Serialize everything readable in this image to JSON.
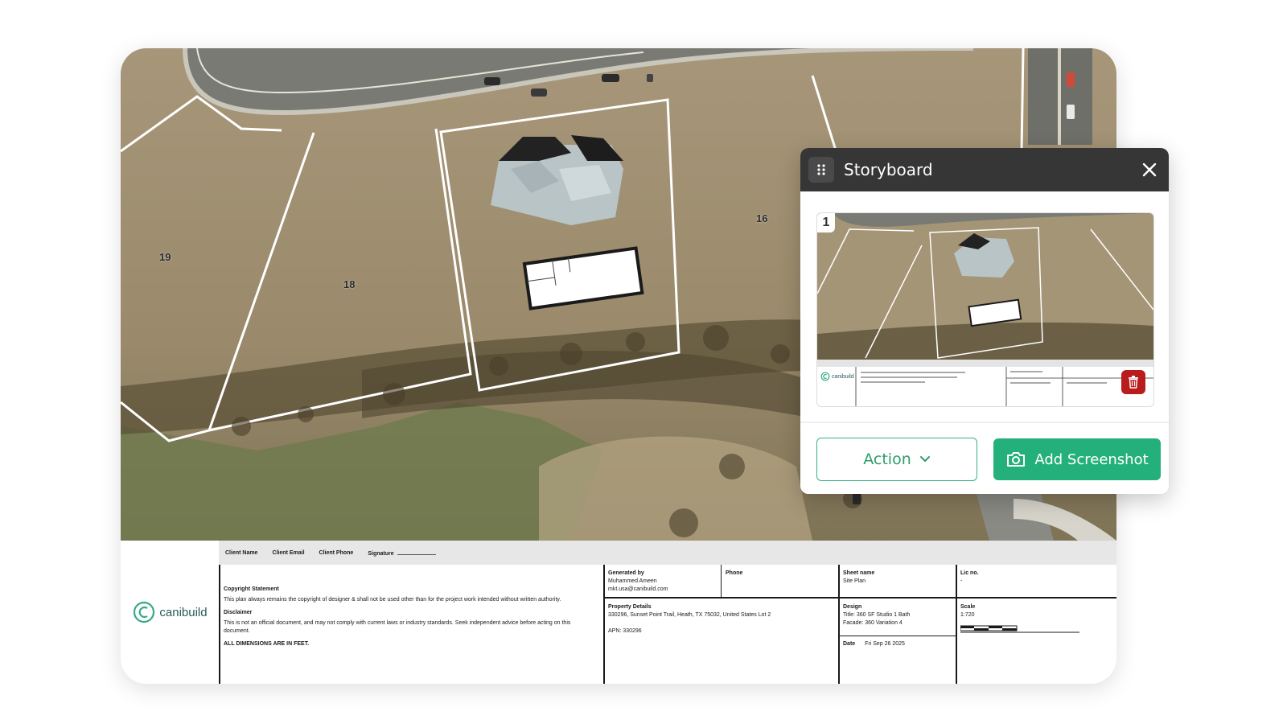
{
  "map": {
    "lot_labels": [
      "19",
      "18",
      "16"
    ]
  },
  "title_block": {
    "brand": "canibuild",
    "header_fields": [
      "Client Name",
      "Client Email",
      "Client Phone",
      "Signature"
    ],
    "copyright_heading": "Copyright Statement",
    "copyright_text": "This plan always remains the copyright of designer & shall not be used other than for the project work intended without written authority.",
    "disclaimer_heading": "Disclaimer",
    "disclaimer_text": "This is not an official document, and may not comply with current laws or industry standards. Seek independent advice before acting on this document.",
    "dimensions_note": "ALL DIMENSIONS ARE IN FEET.",
    "generated_by_label": "Generated by",
    "generated_by_name": "Muhammed Ameen",
    "generated_by_email": "mkt.usa@canibuild.com",
    "phone_label": "Phone",
    "sheet_name_label": "Sheet name",
    "sheet_name_value": "Site Plan",
    "lic_label": "Lic no.",
    "lic_value": "-",
    "property_label": "Property Details",
    "property_address": "330296, Sunset Point Trail, Heath, TX 75032, United States Lot 2",
    "property_apn": "APN: 330296",
    "design_label": "Design",
    "design_title": "Title: 360 SF Studio 1 Bath",
    "design_facade": "Facade: 360 Variation 4",
    "date_label": "Date",
    "date_value": "Fri Sep 26 2025",
    "scale_label": "Scale",
    "scale_value": "1:720"
  },
  "storyboard": {
    "title": "Storyboard",
    "slide_number": "1",
    "thumb_brand": "canibuild",
    "action_label": "Action",
    "add_screenshot_label": "Add Screenshot"
  },
  "colors": {
    "accent_green": "#24b07a",
    "panel_header": "#363636",
    "delete_red": "#b91c1c"
  },
  "icons": [
    "drag-handle-icon",
    "close-icon",
    "trash-icon",
    "chevron-down-icon",
    "camera-icon"
  ]
}
